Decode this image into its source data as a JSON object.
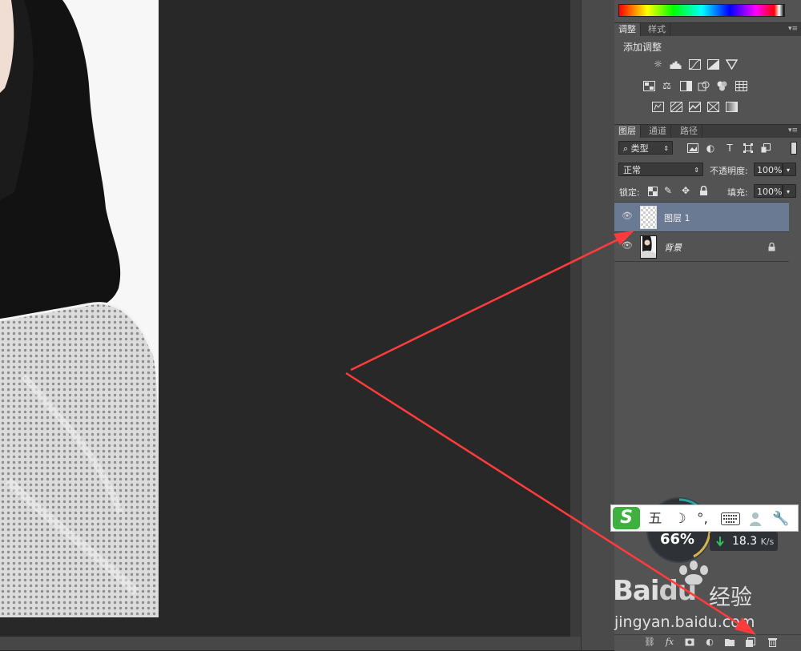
{
  "panels": {
    "adjustments": {
      "tabs": [
        "调整",
        "样式"
      ],
      "title": "添加调整",
      "icons": [
        [
          "brightness-icon",
          "levels-icon",
          "curves-icon",
          "exposure-icon",
          "vibrance-icon"
        ],
        [
          "hue-saturation-icon",
          "color-balance-icon",
          "black-white-icon",
          "photo-filter-icon",
          "channel-mixer-icon",
          "color-lookup-icon"
        ],
        [
          "invert-icon",
          "posterize-icon",
          "threshold-icon",
          "selective-color-icon",
          "gradient-map-icon"
        ]
      ]
    },
    "layers": {
      "tabs": [
        "图层",
        "通道",
        "路径"
      ],
      "filter_kind": "类型",
      "blend_mode": "正常",
      "opacity_label": "不透明度:",
      "opacity_value": "100%",
      "lock_label": "锁定:",
      "fill_label": "填充:",
      "fill_value": "100%",
      "layers": [
        {
          "name": "图层 1",
          "selected": true,
          "locked": false
        },
        {
          "name": "背景",
          "selected": false,
          "locked": true
        }
      ]
    }
  },
  "overlays": {
    "ime": {
      "logo": "S",
      "mode": "五"
    },
    "network": {
      "percent": "66%",
      "speed": "18.3",
      "unit": "K/s"
    },
    "watermark": {
      "brand_a": "Bai",
      "brand_b": "du",
      "brand_cn": "经验",
      "url": "jingyan.baidu.com"
    }
  },
  "colors": {
    "selected_layer": "#6a7a93",
    "arrow": "#ff3b3b",
    "ime_green": "#3db03d"
  }
}
